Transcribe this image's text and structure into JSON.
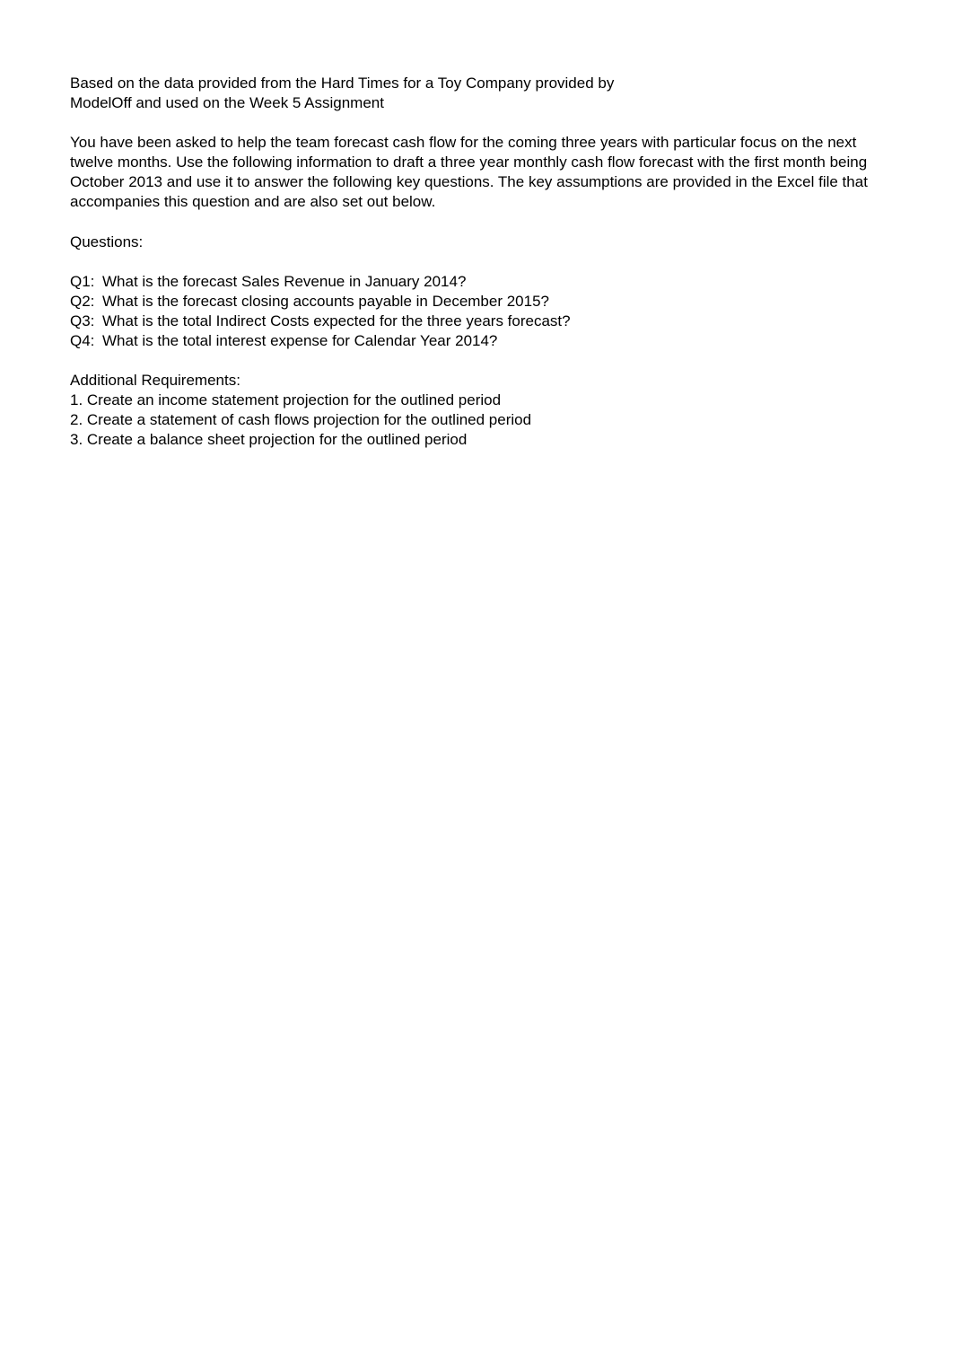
{
  "intro": {
    "line1": "Based on the data provided from the Hard Times for a Toy Company provided by",
    "line2": "ModelOff and used on the Week 5 Assignment"
  },
  "main_paragraph": "You have been asked to help the team forecast cash flow for the coming three years with particular focus on the next twelve months. Use the following information to draft a three year monthly cash flow forecast with the first month being October 2013 and use it to answer the following key questions. The key assumptions are provided in the Excel file that accompanies this question and are also set out below.",
  "questions_heading": "Questions:",
  "questions": [
    {
      "label": "Q1:",
      "text": "What is the forecast Sales Revenue in January 2014?"
    },
    {
      "label": "Q2:",
      "text": "What is the forecast closing accounts payable in December 2015?"
    },
    {
      "label": "Q3:",
      "text": "What is the total Indirect Costs expected for the three years forecast?"
    },
    {
      "label": "Q4:",
      "text": "What is the total interest expense for Calendar Year 2014?"
    }
  ],
  "requirements_heading": "Additional Requirements:",
  "requirements": [
    "1. Create an income statement projection for the outlined period",
    "2.  Create a statement of cash flows projection for the outlined period",
    "3.  Create a balance sheet projection for the outlined period"
  ]
}
